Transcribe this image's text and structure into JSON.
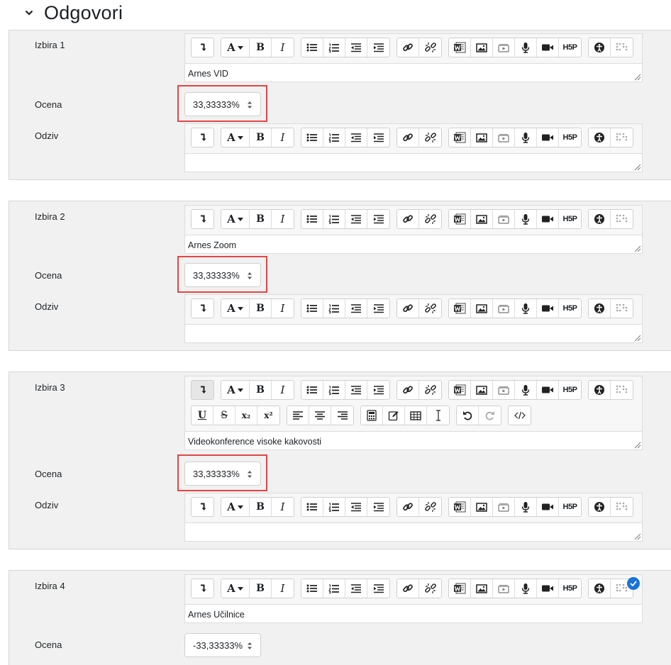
{
  "section": {
    "title": "Odgovori",
    "icon": "chevron-down-icon"
  },
  "labels": {
    "choice_prefix": "Izbira",
    "grade": "Ocena",
    "feedback": "Odziv"
  },
  "choices": [
    {
      "label": "Izbira 1",
      "answer_text": "Arnes VID",
      "grade": "33,33333%",
      "feedback_text": ""
    },
    {
      "label": "Izbira 2",
      "answer_text": "Arnes Zoom",
      "grade": "33,33333%",
      "feedback_text": ""
    },
    {
      "label": "Izbira 3",
      "answer_text": "Videokonference visoke kakovosti",
      "grade": "33,33333%",
      "feedback_text": ""
    },
    {
      "label": "Izbira 4",
      "answer_text": "Arnes Učilnice",
      "grade": "-33,33333%",
      "feedback_text": ""
    }
  ],
  "toolbar_icons": {
    "row1": [
      "expand-toolbar-icon",
      "font-color-icon",
      "bold-icon",
      "italic-icon",
      "unordered-list-icon",
      "ordered-list-icon",
      "outdent-icon",
      "indent-icon",
      "link-icon",
      "unlink-icon",
      "word-import-icon",
      "image-icon",
      "media-icon",
      "record-audio-icon",
      "record-video-icon",
      "h5p-icon",
      "accessibility-checker-icon",
      "screenreader-helper-icon"
    ],
    "row2": [
      "underline-icon",
      "strikethrough-icon",
      "subscript-icon",
      "superscript-icon",
      "align-left-icon",
      "align-center-icon",
      "align-right-icon",
      "equation-editor-icon",
      "manage-files-icon",
      "table-icon",
      "special-character-icon",
      "undo-icon",
      "redo-icon",
      "html-source-icon"
    ]
  },
  "toolbar_text": {
    "bold": "B",
    "italic": "I",
    "font": "A",
    "underline": "U",
    "strike": "S",
    "sub": "x₂",
    "sup": "x²",
    "h5p": "H5P"
  },
  "colors": {
    "highlight": "#e04646",
    "panel_bg": "#f1f1f1",
    "check": "#1a73d9"
  }
}
